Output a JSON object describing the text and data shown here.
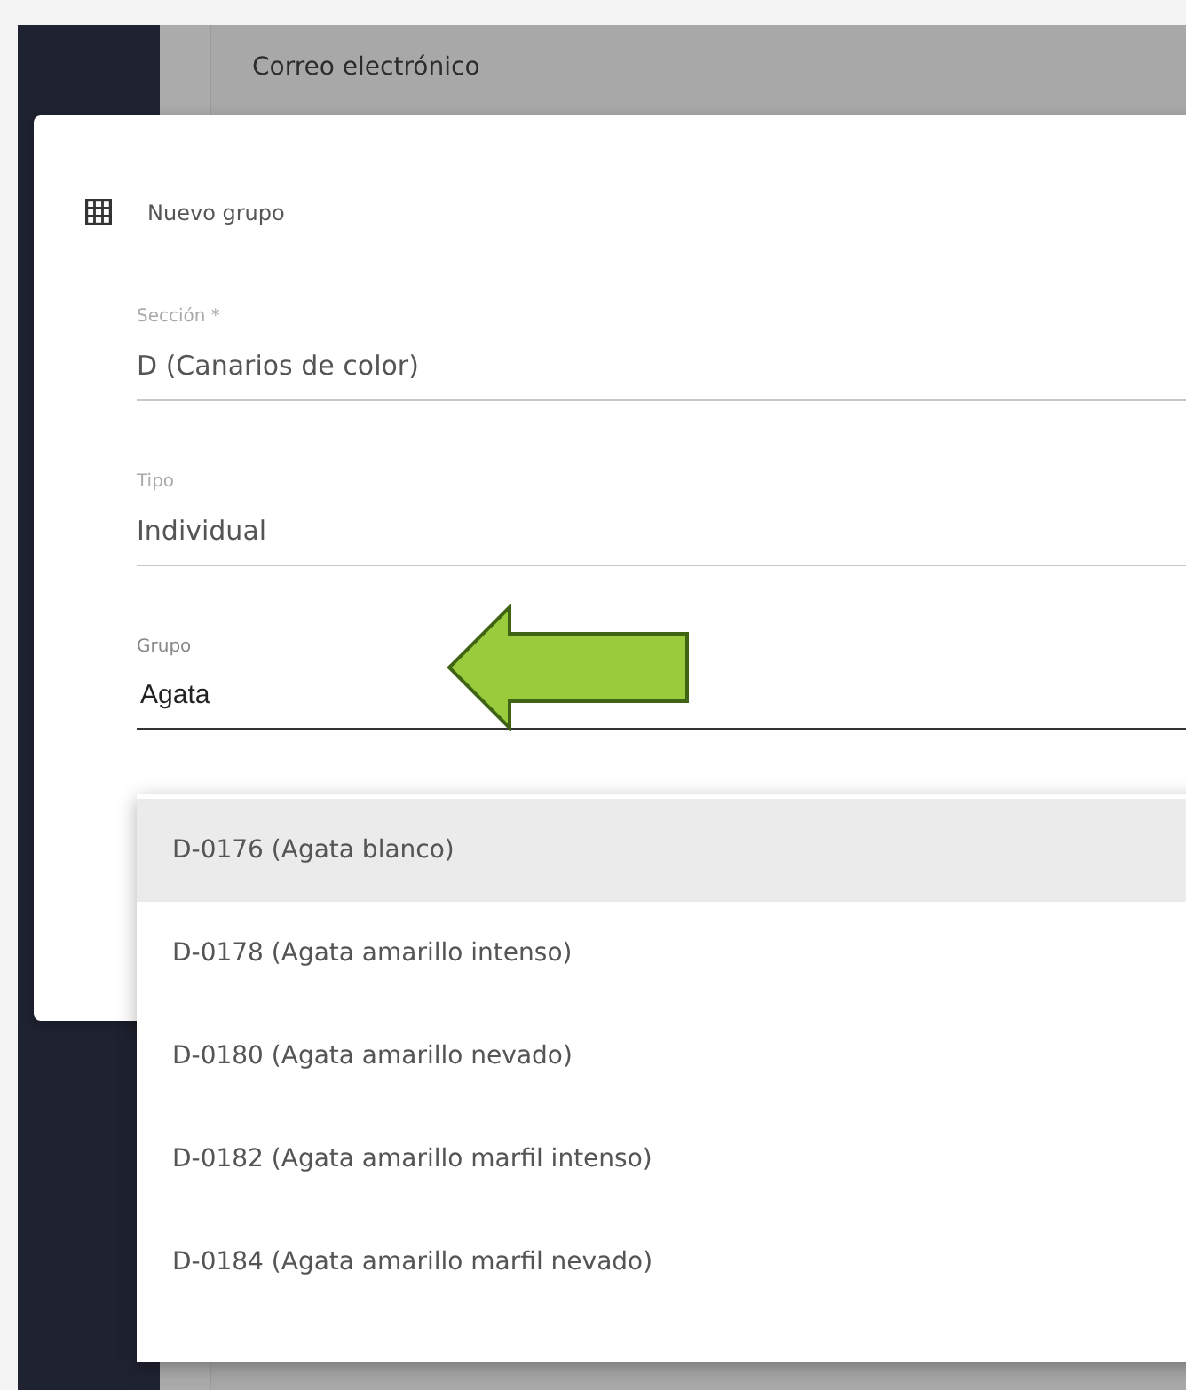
{
  "background": {
    "field_label": "Correo electrónico"
  },
  "dialog": {
    "title": "Nuevo grupo",
    "fields": [
      {
        "label": "Sección *",
        "value": "D (Canarios de color)",
        "focused": false
      },
      {
        "label": "Tipo",
        "value": "Individual",
        "focused": false
      },
      {
        "label": "Grupo",
        "value": "Agata",
        "focused": true
      }
    ]
  },
  "dropdown": {
    "options": [
      {
        "label": "D-0176 (Agata blanco)",
        "selected": true
      },
      {
        "label": "D-0178 (Agata amarillo intenso)",
        "selected": false
      },
      {
        "label": "D-0180 (Agata amarillo nevado)",
        "selected": false
      },
      {
        "label": "D-0182 (Agata amarillo marfil intenso)",
        "selected": false
      },
      {
        "label": "D-0184 (Agata amarillo marfil nevado)",
        "selected": false
      }
    ]
  }
}
